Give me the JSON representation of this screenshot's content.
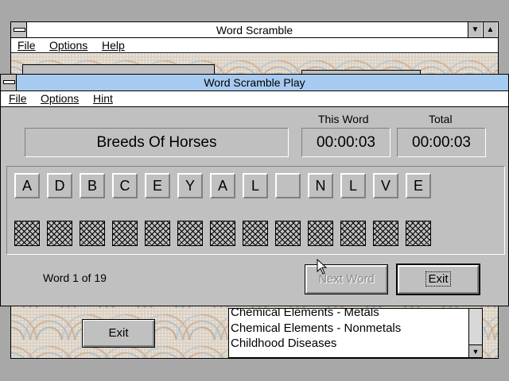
{
  "back_window": {
    "title": "Word Scramble",
    "menu": [
      "File",
      "Options",
      "Help"
    ],
    "exit_label": "Exit",
    "list_items": [
      "Chemical Elements - Metals",
      "Chemical Elements - Nonmetals",
      "Childhood Diseases"
    ]
  },
  "front_window": {
    "title": "Word Scramble Play",
    "menu": [
      "File",
      "Options",
      "Hint"
    ],
    "category": "Breeds Of Horses",
    "this_word_label": "This Word",
    "total_label": "Total",
    "this_word_time": "00:00:03",
    "total_time": "00:00:03",
    "letters": [
      "A",
      "D",
      "B",
      "C",
      "E",
      "Y",
      "A",
      "L",
      "",
      "N",
      "L",
      "V",
      "E"
    ],
    "status": "Word 1 of 19",
    "next_word_label": "Next Word",
    "exit_label": "Exit"
  },
  "icons": {
    "system_menu": "system-menu-icon",
    "minimize": "minimize-arrow-icon",
    "maximize": "maximize-arrow-icon",
    "scroll_down": "scroll-down-arrow-icon",
    "cursor": "mouse-pointer-icon"
  },
  "colors": {
    "active_title": "#a6caf0",
    "face": "#c0c0c0"
  }
}
